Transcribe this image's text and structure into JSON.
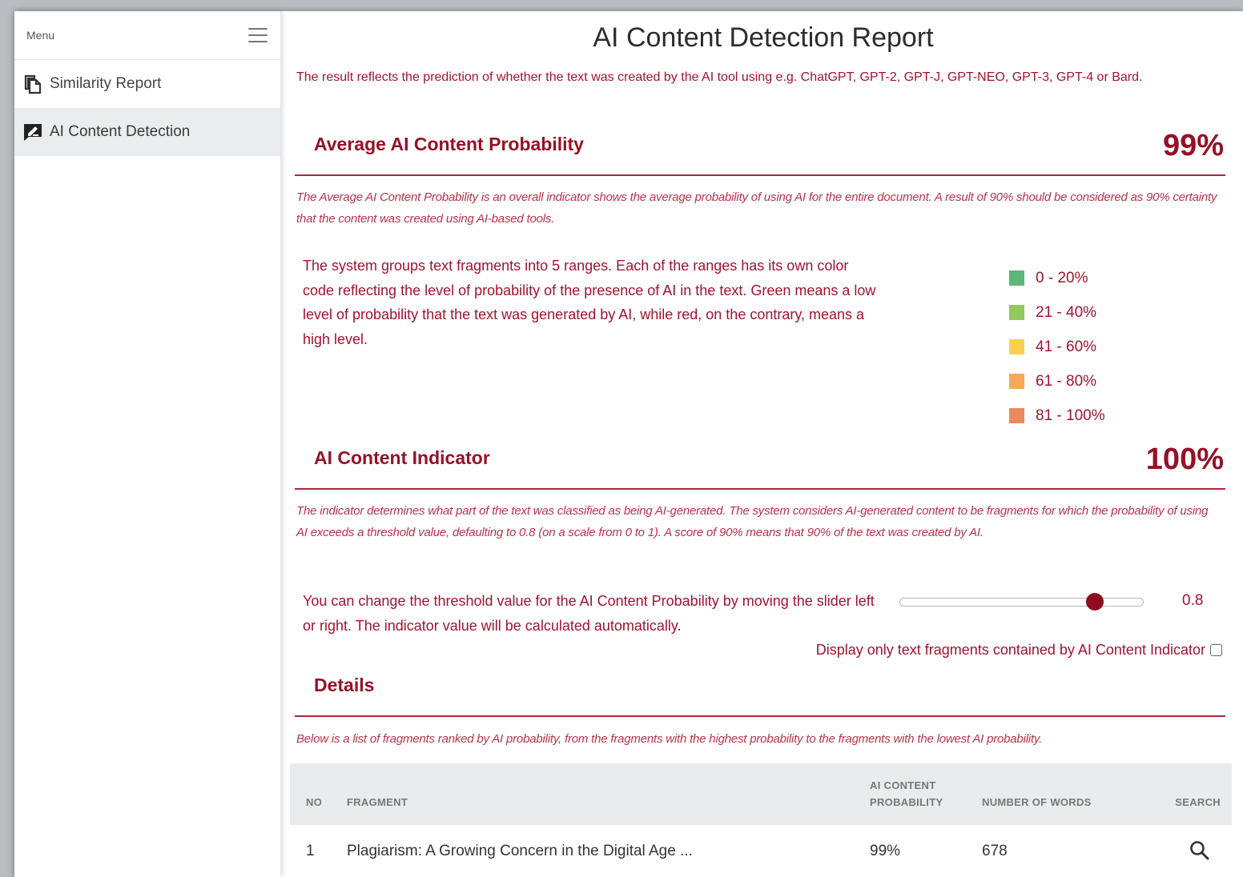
{
  "sidebar": {
    "menu_label": "Menu",
    "items": [
      {
        "label": "Similarity Report",
        "icon": "copy-pages-icon",
        "active": false
      },
      {
        "label": "AI Content Detection",
        "icon": "ai-edit-icon",
        "active": true
      }
    ]
  },
  "report": {
    "title": "AI Content Detection Report",
    "intro": "The result reflects the prediction of whether the text was created by the AI tool using e.g. ChatGPT, GPT-2, GPT-J, GPT-NEO, GPT-3, GPT-4 or Bard."
  },
  "average": {
    "title": "Average AI Content Probability",
    "value": "99%",
    "description": "The Average AI Content Probability is an overall indicator shows the average probability of using AI for the entire document. A result of 90% should be considered as 90% certainty that the content was created using AI-based tools.",
    "ranges_text": "The system groups text fragments into 5 ranges. Each of the ranges has its own color code reflecting the level of probability of the presence of AI in the text. Green means a low level of probability that the text was generated by AI, while red, on the contrary, means a high level."
  },
  "legend": [
    {
      "label": "0 - 20%",
      "color": "#5cb878"
    },
    {
      "label": "21 - 40%",
      "color": "#92c95f"
    },
    {
      "label": "41 - 60%",
      "color": "#f8d24f"
    },
    {
      "label": "61 - 80%",
      "color": "#f3a85c"
    },
    {
      "label": "81 - 100%",
      "color": "#e98a5e"
    }
  ],
  "indicator": {
    "title": "AI Content Indicator",
    "value": "100%",
    "description": "The indicator determines what part of the text was classified as being AI-generated. The system considers AI-generated content to be fragments for which the probability of using AI exceeds a threshold value, defaulting to 0.8 (on a scale from 0 to 1). A score of 90% means that 90% of the text was created by AI.",
    "slider_text": "You can change the threshold value for the AI Content Probability by moving the slider left or right. The indicator value will be calculated automatically.",
    "threshold": 0.8,
    "threshold_label": "0.8",
    "checkbox_label": "Display only text fragments contained by AI Content Indicator",
    "checked": false
  },
  "details": {
    "title": "Details",
    "description": "Below is a list of fragments ranked by AI probability, from the fragments with the highest probability to the fragments with the lowest AI probability.",
    "columns": {
      "no": "NO",
      "fragment": "FRAGMENT",
      "probability_line1": "AI CONTENT",
      "probability_line2": "PROBABILITY",
      "words": "NUMBER OF WORDS",
      "search": "SEARCH"
    },
    "rows": [
      {
        "no": "1",
        "fragment": "Plagiarism: A Growing Concern in the Digital Age ...",
        "probability": "99%",
        "words": "678"
      }
    ]
  },
  "colors": {
    "accent": "#961126",
    "text_red": "#a3132e",
    "thumb": "#8e0d20"
  }
}
